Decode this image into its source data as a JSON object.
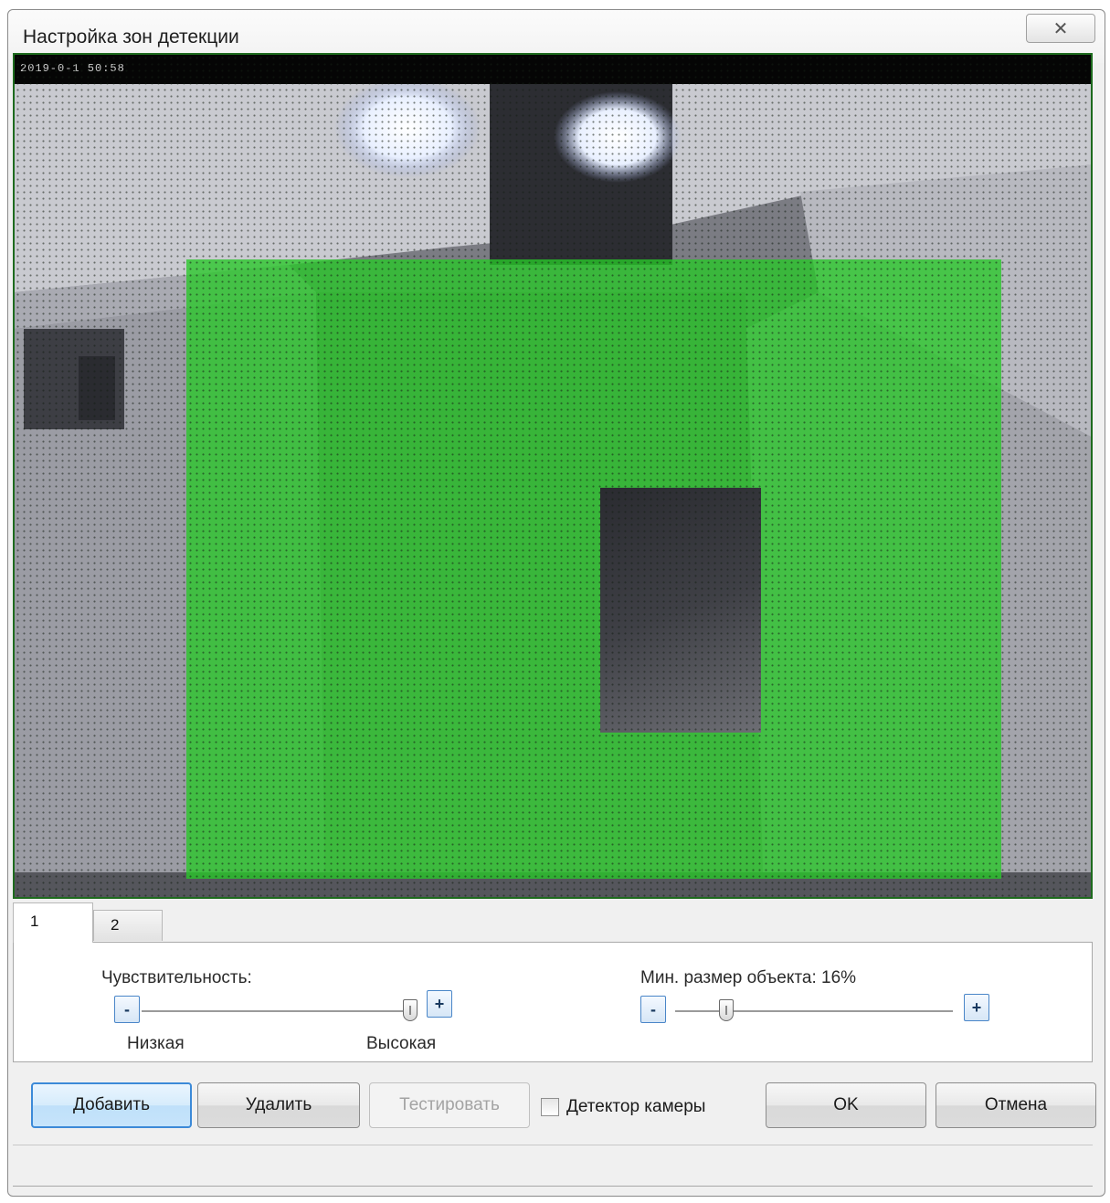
{
  "window": {
    "title": "Настройка зон детекции",
    "close_glyph": "✕"
  },
  "video": {
    "osd_timestamp": "2019-0-1  50:58",
    "zone_color": "#28c828"
  },
  "tabs": [
    {
      "label": "1",
      "active": true
    },
    {
      "label": "2",
      "active": false
    }
  ],
  "sensitivity": {
    "label": "Чувствительность:",
    "minus": "-",
    "plus": "+",
    "low_label": "Низкая",
    "high_label": "Высокая",
    "level": 1.0
  },
  "min_size": {
    "label": "Мин. размер объекта: 16%",
    "minus": "-",
    "plus": "+",
    "percent": 16
  },
  "buttons": {
    "add": "Добавить",
    "delete": "Удалить",
    "test": "Тестировать",
    "ok": "OK",
    "cancel": "Отмена"
  },
  "camera_detector": {
    "label": "Детектор камеры",
    "checked": false
  }
}
